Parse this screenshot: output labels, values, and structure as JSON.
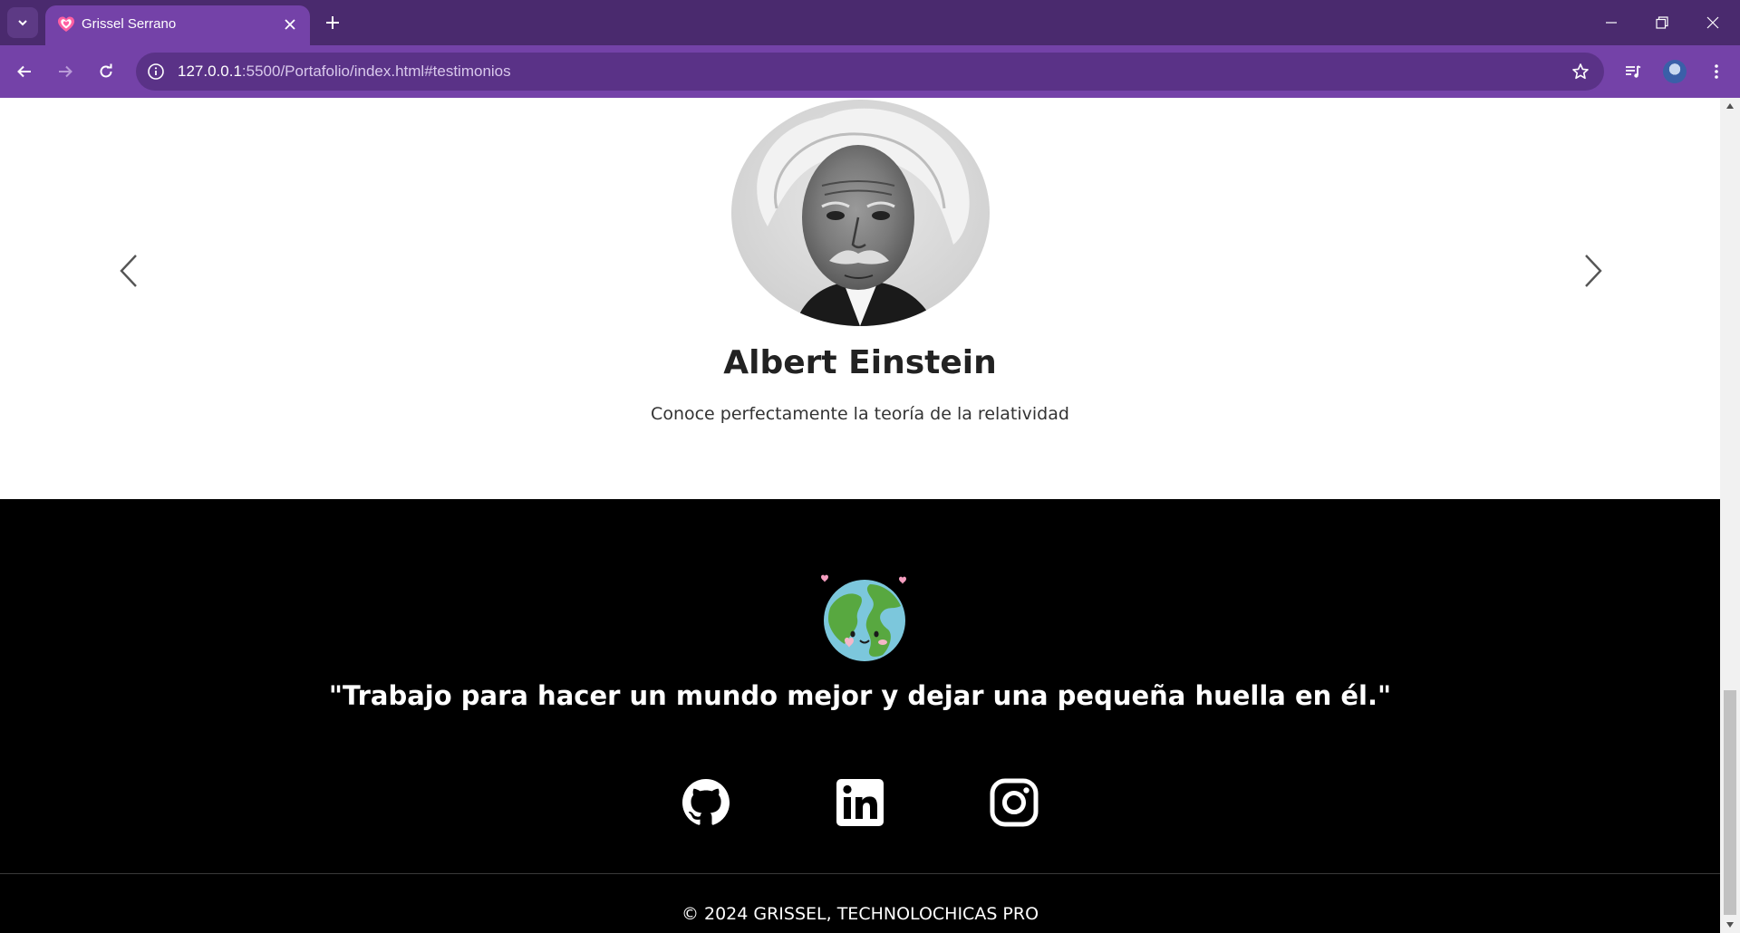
{
  "browser": {
    "tab_title": "Grissel Serrano",
    "url_host": "127.0.0.1",
    "url_rest": ":5500/Portafolio/index.html#testimonios",
    "accent": "#7442a8",
    "frame": "#4a2a6e"
  },
  "testimonial": {
    "name": "Albert Einstein",
    "description": "Conoce perfectamente la teoría de la relatividad",
    "prev_icon": "chevron-left-icon",
    "next_icon": "chevron-right-icon"
  },
  "footer": {
    "quote": "\"Trabajo para hacer un mundo mejor y dejar una pequeña huella en él.\"",
    "social": [
      "github-icon",
      "linkedin-icon",
      "instagram-icon"
    ],
    "copyright": "© 2024 GRISSEL, TECHNOLOCHICAS PRO",
    "background": "#000000"
  }
}
